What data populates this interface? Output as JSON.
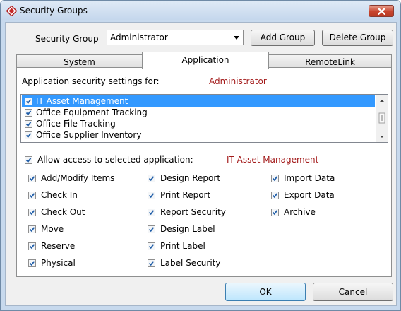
{
  "window": {
    "title": "Security Groups",
    "close_label": "close"
  },
  "security_group": {
    "label": "Security Group",
    "selected": "Administrator",
    "add_label": "Add Group",
    "delete_label": "Delete Group"
  },
  "tabs": [
    {
      "label": "System",
      "active": false
    },
    {
      "label": "Application",
      "active": true
    },
    {
      "label": "RemoteLink",
      "active": false
    }
  ],
  "application": {
    "settings_label": "Application security settings for:",
    "settings_value": "Administrator",
    "apps": [
      {
        "label": "IT Asset Management",
        "checked": true,
        "selected": true
      },
      {
        "label": "Office Equipment Tracking",
        "checked": true,
        "selected": false
      },
      {
        "label": "Office File Tracking",
        "checked": true,
        "selected": false
      },
      {
        "label": "Office Supplier Inventory",
        "checked": true,
        "selected": false
      }
    ],
    "allow_label": "Allow access to selected application:",
    "allow_checked": true,
    "allow_value": "IT Asset Management",
    "permissions": {
      "col1": [
        "Add/Modify Items",
        "Check In",
        "Check Out",
        "Move",
        "Reserve",
        "Physical"
      ],
      "col2": [
        "Design Report",
        "Print Report",
        "Report Security",
        "Design Label",
        "Print Label",
        "Label Security"
      ],
      "col3": [
        "Import Data",
        "Export Data",
        "Archive"
      ]
    }
  },
  "footer": {
    "ok_label": "OK",
    "cancel_label": "Cancel"
  },
  "colors": {
    "accent_red": "#a31a1a",
    "selection_blue": "#3399ff",
    "check_blue": "#1f5da8"
  }
}
